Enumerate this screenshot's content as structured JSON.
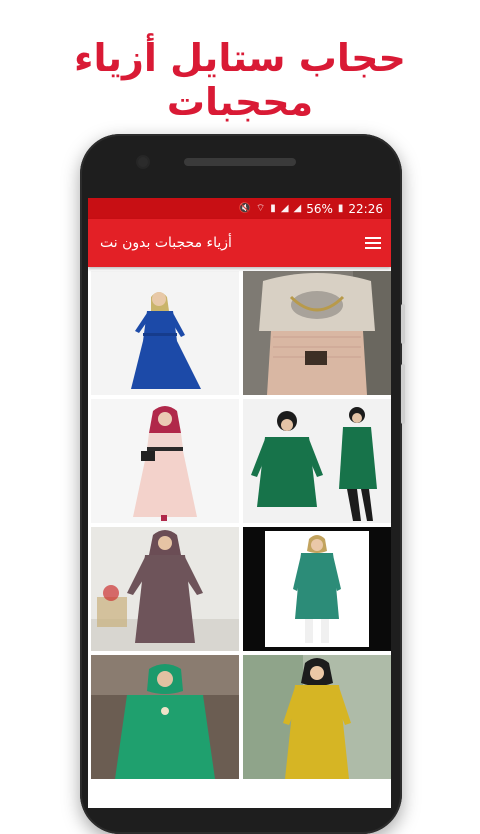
{
  "promo": {
    "title": "حجاب ستايل أزياء محجبات"
  },
  "status_bar": {
    "battery_percent": "56%",
    "time": "22:26",
    "icons": [
      "mute-icon",
      "wifi-icon",
      "sim-icon",
      "signal-icon",
      "signal-icon",
      "battery-icon"
    ]
  },
  "toolbar": {
    "title": "أزياء محجبات بدون نت",
    "menu_icon": "hamburger-menu-icon"
  },
  "colors": {
    "brand_red": "#e32026",
    "status_red": "#c80f14",
    "promo_red": "#d91a35"
  },
  "gallery": {
    "items": [
      {
        "id": 1,
        "description": "blue dress"
      },
      {
        "id": 2,
        "description": "beige outfit"
      },
      {
        "id": 3,
        "description": "pink dress"
      },
      {
        "id": 4,
        "description": "green tunics"
      },
      {
        "id": 5,
        "description": "mauve dress"
      },
      {
        "id": 6,
        "description": "teal tunic"
      },
      {
        "id": 7,
        "description": "green tunic"
      },
      {
        "id": 8,
        "description": "mustard tunic"
      }
    ]
  }
}
